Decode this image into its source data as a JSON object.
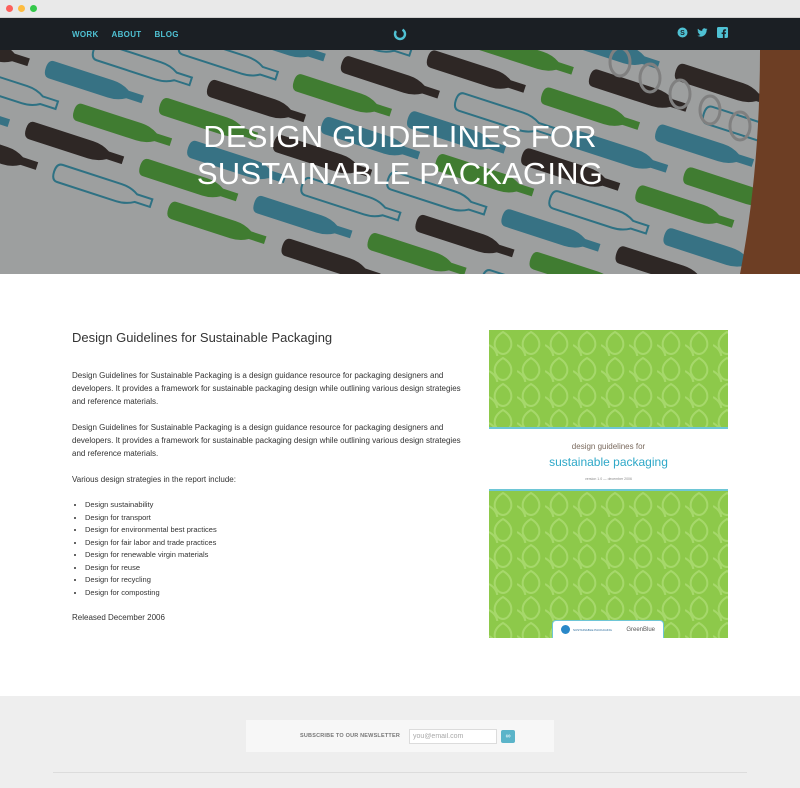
{
  "nav": {
    "links": [
      "WORK",
      "ABOUT",
      "BLOG"
    ],
    "socials": [
      "skype-icon",
      "twitter-icon",
      "facebook-icon"
    ],
    "colors": {
      "bar": "#1b1f24",
      "link": "#4fc1d3"
    }
  },
  "hero": {
    "title": "DESIGN GUIDELINES FOR SUSTAINABLE PACKAGING"
  },
  "content": {
    "heading": "Design Guidelines for Sustainable Packaging",
    "paragraphs": [
      "Design Guidelines for Sustainable Packaging is a design guidance resource for packaging designers and developers. It provides a framework for sustainable packaging design while outlining various design strategies and reference materials.",
      "Design Guidelines for Sustainable Packaging is a design guidance resource for packaging designers and developers. It provides a framework for sustainable packaging design while outlining various design strategies and reference materials."
    ],
    "list_intro": "Various design strategies in the report include:",
    "strategies": [
      "Design sustainability",
      "Design for transport",
      "Design for environmental best practices",
      "Design for fair labor and trade practices",
      "Design for renewable virgin materials",
      "Design for reuse",
      "Design for recycling",
      "Design for composting"
    ],
    "released": "Released December 2006"
  },
  "cover": {
    "line1": "design guidelines for",
    "line2": "sustainable packaging",
    "line3": "version 1.0 — december 2006",
    "logo_left": "SUSTAINABLE PACKAGING",
    "logo_right": "GreenBlue"
  },
  "newsletter": {
    "label": "SUBSCRIBE TO OUR NEWSLETTER",
    "placeholder": "you@email.com",
    "button": "∞"
  }
}
